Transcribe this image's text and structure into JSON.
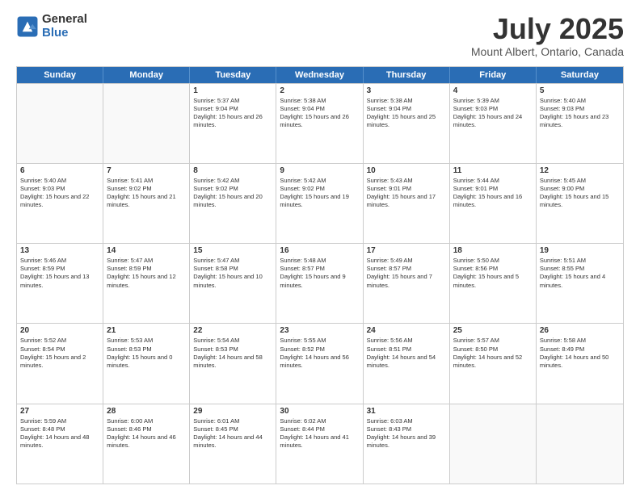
{
  "logo": {
    "general": "General",
    "blue": "Blue"
  },
  "header": {
    "title": "July 2025",
    "location": "Mount Albert, Ontario, Canada"
  },
  "weekdays": [
    "Sunday",
    "Monday",
    "Tuesday",
    "Wednesday",
    "Thursday",
    "Friday",
    "Saturday"
  ],
  "weeks": [
    [
      {
        "day": "",
        "sunrise": "",
        "sunset": "",
        "daylight": ""
      },
      {
        "day": "",
        "sunrise": "",
        "sunset": "",
        "daylight": ""
      },
      {
        "day": "1",
        "sunrise": "Sunrise: 5:37 AM",
        "sunset": "Sunset: 9:04 PM",
        "daylight": "Daylight: 15 hours and 26 minutes."
      },
      {
        "day": "2",
        "sunrise": "Sunrise: 5:38 AM",
        "sunset": "Sunset: 9:04 PM",
        "daylight": "Daylight: 15 hours and 26 minutes."
      },
      {
        "day": "3",
        "sunrise": "Sunrise: 5:38 AM",
        "sunset": "Sunset: 9:04 PM",
        "daylight": "Daylight: 15 hours and 25 minutes."
      },
      {
        "day": "4",
        "sunrise": "Sunrise: 5:39 AM",
        "sunset": "Sunset: 9:03 PM",
        "daylight": "Daylight: 15 hours and 24 minutes."
      },
      {
        "day": "5",
        "sunrise": "Sunrise: 5:40 AM",
        "sunset": "Sunset: 9:03 PM",
        "daylight": "Daylight: 15 hours and 23 minutes."
      }
    ],
    [
      {
        "day": "6",
        "sunrise": "Sunrise: 5:40 AM",
        "sunset": "Sunset: 9:03 PM",
        "daylight": "Daylight: 15 hours and 22 minutes."
      },
      {
        "day": "7",
        "sunrise": "Sunrise: 5:41 AM",
        "sunset": "Sunset: 9:02 PM",
        "daylight": "Daylight: 15 hours and 21 minutes."
      },
      {
        "day": "8",
        "sunrise": "Sunrise: 5:42 AM",
        "sunset": "Sunset: 9:02 PM",
        "daylight": "Daylight: 15 hours and 20 minutes."
      },
      {
        "day": "9",
        "sunrise": "Sunrise: 5:42 AM",
        "sunset": "Sunset: 9:02 PM",
        "daylight": "Daylight: 15 hours and 19 minutes."
      },
      {
        "day": "10",
        "sunrise": "Sunrise: 5:43 AM",
        "sunset": "Sunset: 9:01 PM",
        "daylight": "Daylight: 15 hours and 17 minutes."
      },
      {
        "day": "11",
        "sunrise": "Sunrise: 5:44 AM",
        "sunset": "Sunset: 9:01 PM",
        "daylight": "Daylight: 15 hours and 16 minutes."
      },
      {
        "day": "12",
        "sunrise": "Sunrise: 5:45 AM",
        "sunset": "Sunset: 9:00 PM",
        "daylight": "Daylight: 15 hours and 15 minutes."
      }
    ],
    [
      {
        "day": "13",
        "sunrise": "Sunrise: 5:46 AM",
        "sunset": "Sunset: 8:59 PM",
        "daylight": "Daylight: 15 hours and 13 minutes."
      },
      {
        "day": "14",
        "sunrise": "Sunrise: 5:47 AM",
        "sunset": "Sunset: 8:59 PM",
        "daylight": "Daylight: 15 hours and 12 minutes."
      },
      {
        "day": "15",
        "sunrise": "Sunrise: 5:47 AM",
        "sunset": "Sunset: 8:58 PM",
        "daylight": "Daylight: 15 hours and 10 minutes."
      },
      {
        "day": "16",
        "sunrise": "Sunrise: 5:48 AM",
        "sunset": "Sunset: 8:57 PM",
        "daylight": "Daylight: 15 hours and 9 minutes."
      },
      {
        "day": "17",
        "sunrise": "Sunrise: 5:49 AM",
        "sunset": "Sunset: 8:57 PM",
        "daylight": "Daylight: 15 hours and 7 minutes."
      },
      {
        "day": "18",
        "sunrise": "Sunrise: 5:50 AM",
        "sunset": "Sunset: 8:56 PM",
        "daylight": "Daylight: 15 hours and 5 minutes."
      },
      {
        "day": "19",
        "sunrise": "Sunrise: 5:51 AM",
        "sunset": "Sunset: 8:55 PM",
        "daylight": "Daylight: 15 hours and 4 minutes."
      }
    ],
    [
      {
        "day": "20",
        "sunrise": "Sunrise: 5:52 AM",
        "sunset": "Sunset: 8:54 PM",
        "daylight": "Daylight: 15 hours and 2 minutes."
      },
      {
        "day": "21",
        "sunrise": "Sunrise: 5:53 AM",
        "sunset": "Sunset: 8:53 PM",
        "daylight": "Daylight: 15 hours and 0 minutes."
      },
      {
        "day": "22",
        "sunrise": "Sunrise: 5:54 AM",
        "sunset": "Sunset: 8:53 PM",
        "daylight": "Daylight: 14 hours and 58 minutes."
      },
      {
        "day": "23",
        "sunrise": "Sunrise: 5:55 AM",
        "sunset": "Sunset: 8:52 PM",
        "daylight": "Daylight: 14 hours and 56 minutes."
      },
      {
        "day": "24",
        "sunrise": "Sunrise: 5:56 AM",
        "sunset": "Sunset: 8:51 PM",
        "daylight": "Daylight: 14 hours and 54 minutes."
      },
      {
        "day": "25",
        "sunrise": "Sunrise: 5:57 AM",
        "sunset": "Sunset: 8:50 PM",
        "daylight": "Daylight: 14 hours and 52 minutes."
      },
      {
        "day": "26",
        "sunrise": "Sunrise: 5:58 AM",
        "sunset": "Sunset: 8:49 PM",
        "daylight": "Daylight: 14 hours and 50 minutes."
      }
    ],
    [
      {
        "day": "27",
        "sunrise": "Sunrise: 5:59 AM",
        "sunset": "Sunset: 8:48 PM",
        "daylight": "Daylight: 14 hours and 48 minutes."
      },
      {
        "day": "28",
        "sunrise": "Sunrise: 6:00 AM",
        "sunset": "Sunset: 8:46 PM",
        "daylight": "Daylight: 14 hours and 46 minutes."
      },
      {
        "day": "29",
        "sunrise": "Sunrise: 6:01 AM",
        "sunset": "Sunset: 8:45 PM",
        "daylight": "Daylight: 14 hours and 44 minutes."
      },
      {
        "day": "30",
        "sunrise": "Sunrise: 6:02 AM",
        "sunset": "Sunset: 8:44 PM",
        "daylight": "Daylight: 14 hours and 41 minutes."
      },
      {
        "day": "31",
        "sunrise": "Sunrise: 6:03 AM",
        "sunset": "Sunset: 8:43 PM",
        "daylight": "Daylight: 14 hours and 39 minutes."
      },
      {
        "day": "",
        "sunrise": "",
        "sunset": "",
        "daylight": ""
      },
      {
        "day": "",
        "sunrise": "",
        "sunset": "",
        "daylight": ""
      }
    ]
  ]
}
